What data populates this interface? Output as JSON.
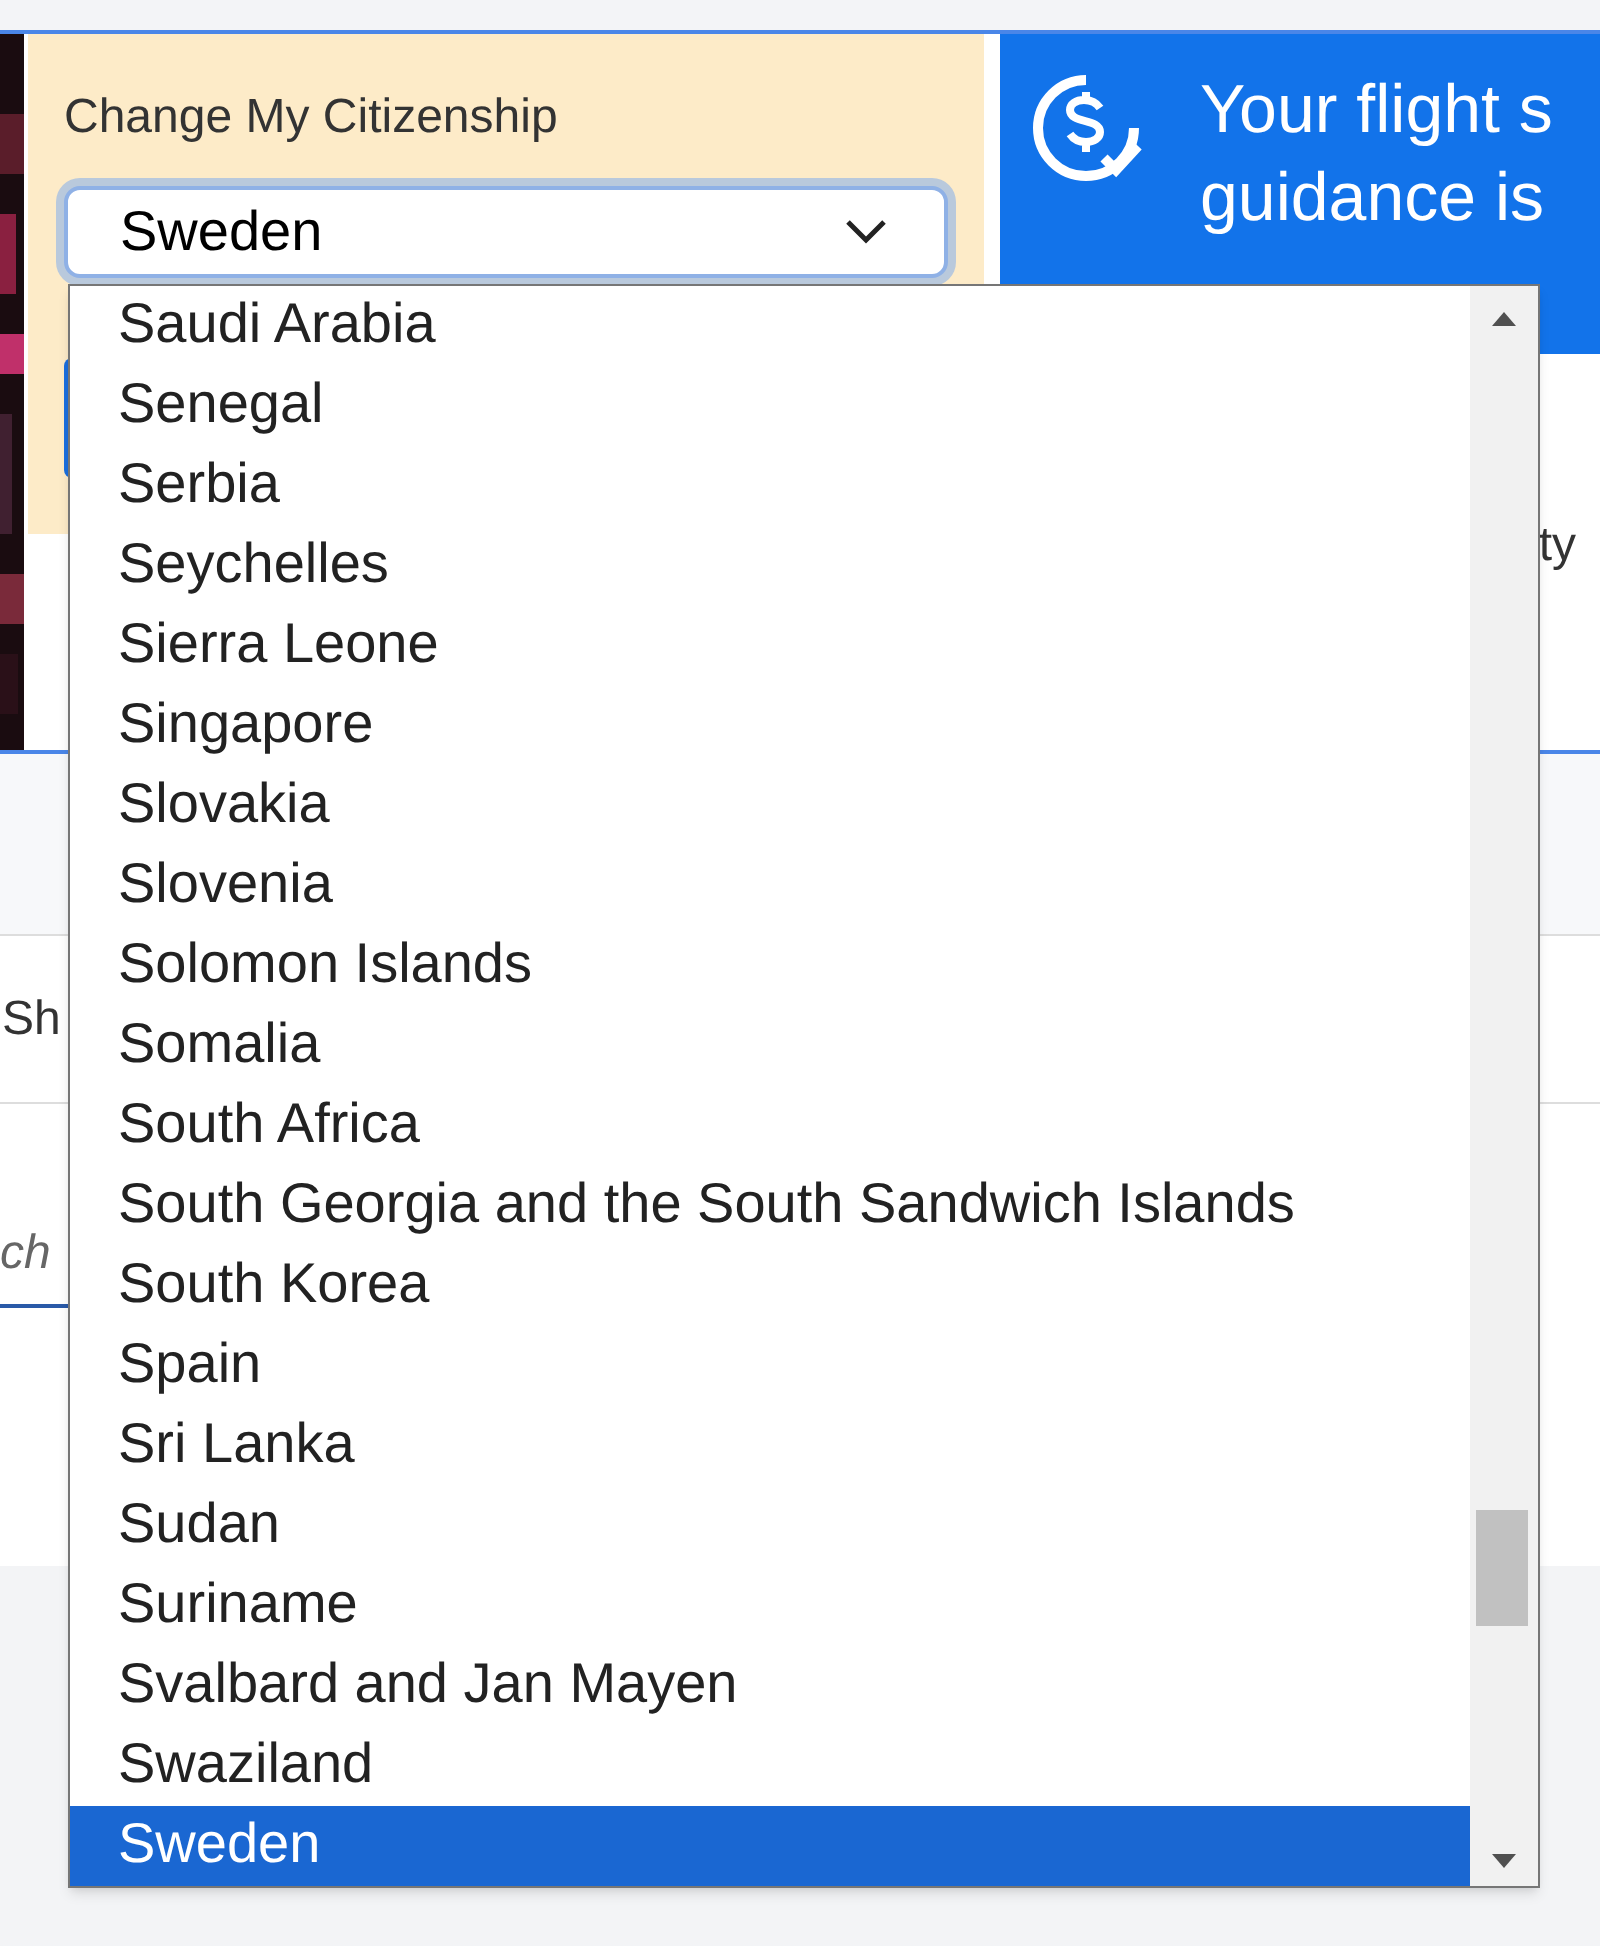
{
  "citizenship": {
    "label": "Change My Citizenship",
    "value": "Sweden"
  },
  "banner": {
    "lines": [
      "Your flight s",
      "guidance is"
    ]
  },
  "background_fragments": [
    "ty",
    "Sh",
    "ch"
  ],
  "dropdown": {
    "options": [
      {
        "label": "Saudi Arabia",
        "selected": false
      },
      {
        "label": "Senegal",
        "selected": false
      },
      {
        "label": "Serbia",
        "selected": false
      },
      {
        "label": "Seychelles",
        "selected": false
      },
      {
        "label": "Sierra Leone",
        "selected": false
      },
      {
        "label": "Singapore",
        "selected": false
      },
      {
        "label": "Slovakia",
        "selected": false
      },
      {
        "label": "Slovenia",
        "selected": false
      },
      {
        "label": "Solomon Islands",
        "selected": false
      },
      {
        "label": "Somalia",
        "selected": false
      },
      {
        "label": "South Africa",
        "selected": false
      },
      {
        "label": "South Georgia and the South Sandwich Islands",
        "selected": false
      },
      {
        "label": "South Korea",
        "selected": false
      },
      {
        "label": "Spain",
        "selected": false
      },
      {
        "label": "Sri Lanka",
        "selected": false
      },
      {
        "label": "Sudan",
        "selected": false
      },
      {
        "label": "Suriname",
        "selected": false
      },
      {
        "label": "Svalbard and Jan Mayen",
        "selected": false
      },
      {
        "label": "Swaziland",
        "selected": false
      },
      {
        "label": "Sweden",
        "selected": true
      }
    ]
  }
}
